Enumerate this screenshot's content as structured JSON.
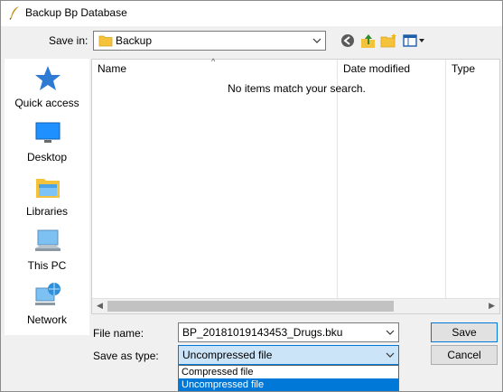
{
  "window": {
    "title": "Backup Bp Database"
  },
  "toolbar": {
    "save_in_label": "Save in:",
    "save_in_value": "Backup",
    "buttons": [
      "back-icon",
      "up-folder-icon",
      "new-folder-icon",
      "view-menu-icon"
    ]
  },
  "places": [
    {
      "label": "Quick access",
      "icon": "quick-access-star-icon"
    },
    {
      "label": "Desktop",
      "icon": "desktop-icon"
    },
    {
      "label": "Libraries",
      "icon": "libraries-icon"
    },
    {
      "label": "This PC",
      "icon": "this-pc-icon"
    },
    {
      "label": "Network",
      "icon": "network-icon"
    }
  ],
  "file_list": {
    "columns": [
      "Name",
      "Date modified",
      "Type"
    ],
    "empty_message": "No items match your search."
  },
  "form": {
    "file_name_label": "File name:",
    "file_name_value": "BP_20181019143453_Drugs.bku",
    "save_type_label": "Save as type:",
    "save_type_value": "Uncompressed file",
    "save_type_options": [
      "Compressed file",
      "Uncompressed file"
    ]
  },
  "buttons": {
    "save": "Save",
    "cancel": "Cancel"
  },
  "colors": {
    "accent": "#0078d7",
    "folder": "#f5c33b"
  }
}
